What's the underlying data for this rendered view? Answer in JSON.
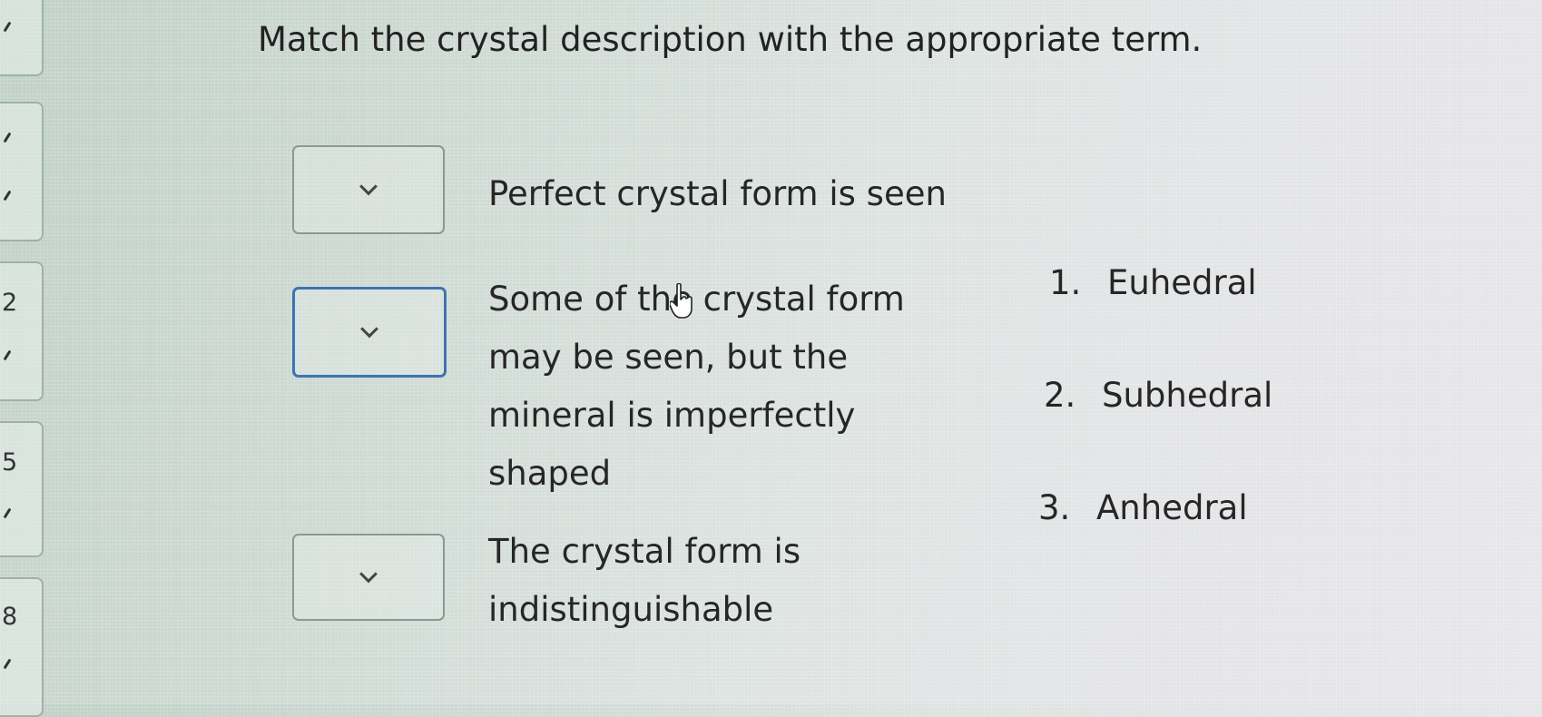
{
  "sidebar": {
    "numbers": [
      "2",
      "5",
      "8"
    ]
  },
  "question": {
    "title": "Match the crystal description with the appropriate term.",
    "items": [
      {
        "description": "Perfect crystal form is seen",
        "selected": ""
      },
      {
        "description": "Some of the crystal form may be seen, but the mineral is imperfectly shaped",
        "selected": ""
      },
      {
        "description": "The crystal form is indistinguishable",
        "selected": ""
      }
    ],
    "options": [
      {
        "number": "1.",
        "label": "Euhedral"
      },
      {
        "number": "2.",
        "label": "Subhedral"
      },
      {
        "number": "3.",
        "label": "Anhedral"
      }
    ]
  },
  "icons": {
    "dropdown": "chevron-down-icon",
    "checkmark": "check-icon",
    "cursor": "pointer-cursor-icon"
  },
  "colors": {
    "focus_border": "#3f73b0",
    "dropdown_border": "#8d9893"
  }
}
